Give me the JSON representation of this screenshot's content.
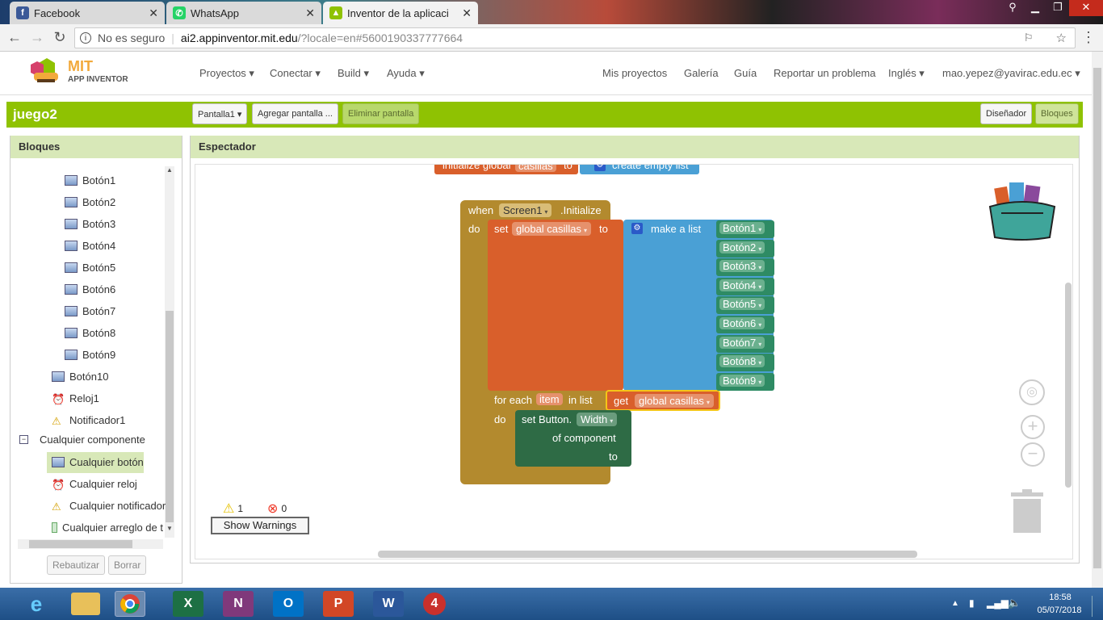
{
  "browser": {
    "tabs": [
      {
        "label": "Facebook",
        "icon": "facebook-icon",
        "color": "#3b5998"
      },
      {
        "label": "WhatsApp",
        "icon": "whatsapp-icon",
        "color": "#25d366"
      },
      {
        "label": "Inventor de la aplicaci",
        "icon": "app-inventor-icon",
        "color": "#8fc202"
      }
    ],
    "security_label": "No es seguro",
    "url_host": "ai2.appinventor.mit.edu",
    "url_path": "/?locale=en#5600190337777664"
  },
  "app": {
    "logo_top": "MIT",
    "logo_bottom": "APP INVENTOR",
    "menu_left": [
      "Proyectos ▾",
      "Conectar ▾",
      "Build ▾",
      "Ayuda ▾"
    ],
    "menu_right": [
      "Mis proyectos",
      "Galería",
      "Guía",
      "Reportar un problema",
      "Inglés ▾",
      "mao.yepez@yavirac.edu.ec ▾"
    ],
    "project_name": "juego2",
    "screen_button": "Pantalla1 ▾",
    "add_screen": "Agregar pantalla ...",
    "remove_screen": "Eliminar pantalla",
    "designer": "Diseñador",
    "blocks": "Bloques"
  },
  "left_panel": {
    "title": "Bloques",
    "items": [
      "Botón1",
      "Botón2",
      "Botón3",
      "Botón4",
      "Botón5",
      "Botón6",
      "Botón7",
      "Botón8",
      "Botón9"
    ],
    "item10": "Botón10",
    "clock": "Reloj1",
    "notifier": "Notificador1",
    "any_component": "Cualquier componente",
    "any_button": "Cualquier botón",
    "any_clock": "Cualquier reloj",
    "any_notifier": "Cualquier notificador",
    "any_arrangement": "Cualquier arreglo de t",
    "rename": "Rebautizar",
    "delete": "Borrar"
  },
  "viewer": {
    "title": "Espectador",
    "init_global": "initialize global",
    "init_var": "casillas",
    "init_to": "to",
    "create_empty": "create empty list",
    "when": "when",
    "screen": "Screen1",
    "initialize": ".Initialize",
    "do": "do",
    "set": "set",
    "global_casillas": "global casillas",
    "to": "to",
    "make_list": "make a list",
    "buttons": [
      "Botón1",
      "Botón2",
      "Botón3",
      "Botón4",
      "Botón5",
      "Botón6",
      "Botón7",
      "Botón8",
      "Botón9"
    ],
    "for_each": "for each",
    "item": "item",
    "in_list": "in list",
    "get": "get",
    "do2": "do",
    "set_button": "set Button.",
    "width": "Width",
    "of_component": "of component",
    "to2": "to",
    "warnings_count": "1",
    "errors_count": "0",
    "show_warnings": "Show Warnings"
  },
  "taskbar": {
    "time": "18:58",
    "date": "05/07/2018"
  }
}
